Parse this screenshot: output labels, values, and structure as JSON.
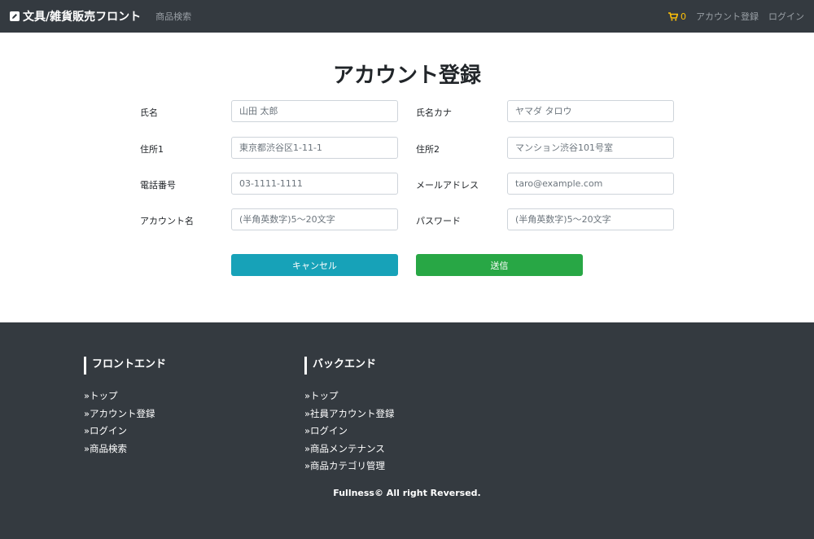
{
  "navbar": {
    "brand": "文具/雑貨販売フロント",
    "search_link": "商品検索",
    "cart_count": "0",
    "register_link": "アカウント登録",
    "login_link": "ログイン"
  },
  "form": {
    "title": "アカウント登録",
    "fields": [
      {
        "label": "氏名",
        "placeholder": "山田 太郎"
      },
      {
        "label": "氏名カナ",
        "placeholder": "ヤマダ タロウ"
      },
      {
        "label": "住所1",
        "placeholder": "東京都渋谷区1-11-1"
      },
      {
        "label": "住所2",
        "placeholder": "マンション渋谷101号室"
      },
      {
        "label": "電話番号",
        "placeholder": "03-1111-1111"
      },
      {
        "label": "メールアドレス",
        "placeholder": "taro@example.com"
      },
      {
        "label": "アカウント名",
        "placeholder": "(半角英数字)5〜20文字"
      },
      {
        "label": "パスワード",
        "placeholder": "(半角英数字)5〜20文字"
      }
    ],
    "cancel_label": "キャンセル",
    "submit_label": "送信"
  },
  "footer": {
    "frontend": {
      "heading": "フロントエンド",
      "links": [
        "»トップ",
        "»アカウント登録",
        "»ログイン",
        "»商品検索"
      ]
    },
    "backend": {
      "heading": "バックエンド",
      "links": [
        "»トップ",
        "»社員アカウント登録",
        "»ログイン",
        "»商品メンテナンス",
        "»商品カテゴリ管理"
      ]
    },
    "copyright": "Fullness© All right Reversed."
  },
  "colors": {
    "navbar_bg": "#343a40",
    "cart_accent": "#ffc107",
    "cancel_button": "#17a2b8",
    "submit_button": "#28a745"
  },
  "icons": {
    "brand": "pencil-square-icon",
    "cart": "shopping-cart-icon"
  }
}
